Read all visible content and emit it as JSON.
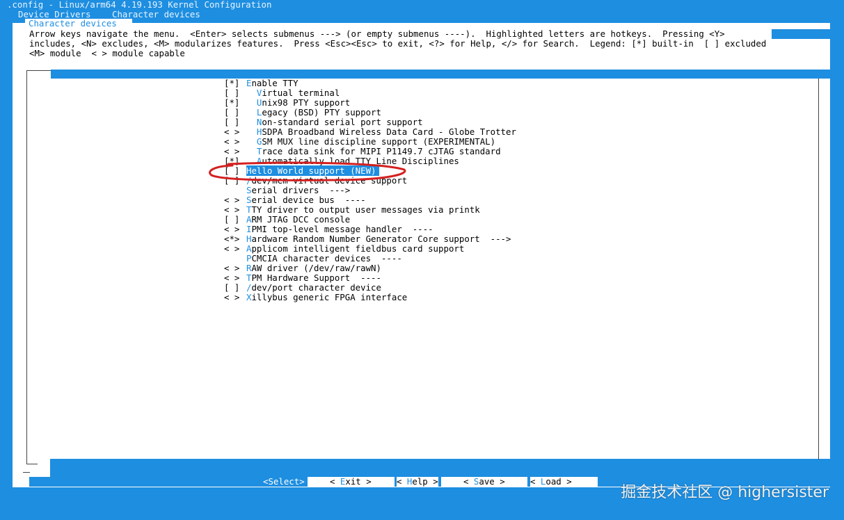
{
  "header": {
    "title": ".config - Linux/arm64 4.19.193 Kernel Configuration",
    "breadcrumb_1": "Device Drivers",
    "breadcrumb_2": "Character devices"
  },
  "dialog": {
    "title": "Character devices",
    "help_line_1": "Arrow keys navigate the menu.  <Enter> selects submenus ---> (or empty submenus ----).  Highlighted letters are hotkeys.  Pressing <Y>",
    "help_line_2": "includes, <N> excludes, <M> modularizes features.  Press <Esc><Esc> to exit, <?> for Help, </> for Search.  Legend: [*] built-in  [ ] excluded",
    "help_line_3": "<M> module  < > module capable"
  },
  "menu": {
    "items": [
      {
        "prefix": "[*]",
        "hotkey": "E",
        "rest": "nable TTY",
        "indent": ""
      },
      {
        "prefix": "[ ]",
        "hotkey": "V",
        "rest": "irtual terminal",
        "indent": "  "
      },
      {
        "prefix": "[*]",
        "hotkey": "U",
        "rest": "nix98 PTY support",
        "indent": "  "
      },
      {
        "prefix": "[ ]",
        "hotkey": "L",
        "rest": "egacy (BSD) PTY support",
        "indent": "  "
      },
      {
        "prefix": "[ ]",
        "hotkey": "N",
        "rest": "on-standard serial port support",
        "indent": "  "
      },
      {
        "prefix": "< >",
        "hotkey": "H",
        "rest": "SDPA Broadband Wireless Data Card - Globe Trotter",
        "indent": "  "
      },
      {
        "prefix": "< >",
        "hotkey": "G",
        "rest": "SM MUX line discipline support (EXPERIMENTAL)",
        "indent": "  "
      },
      {
        "prefix": "< >",
        "hotkey": "T",
        "rest": "race data sink for MIPI P1149.7 cJTAG standard",
        "indent": "  "
      },
      {
        "prefix": "[*]",
        "hotkey": "A",
        "rest": "utomatically load TTY Line Disciplines",
        "indent": "  "
      },
      {
        "prefix": "[ ]",
        "hotkey": "H",
        "rest": "ello World support (NEW)",
        "indent": ""
      },
      {
        "prefix": "[ ]",
        "hotkey": "/",
        "rest": "dev/mem virtual device support",
        "indent": ""
      },
      {
        "prefix": "   ",
        "hotkey": "S",
        "rest": "erial drivers  --->",
        "indent": ""
      },
      {
        "prefix": "< >",
        "hotkey": "S",
        "rest": "erial device bus  ----",
        "indent": ""
      },
      {
        "prefix": "< >",
        "hotkey": "T",
        "rest": "TY driver to output user messages via printk",
        "indent": ""
      },
      {
        "prefix": "[ ]",
        "hotkey": "A",
        "rest": "RM JTAG DCC console",
        "indent": ""
      },
      {
        "prefix": "< >",
        "hotkey": "I",
        "rest": "PMI top-level message handler  ----",
        "indent": ""
      },
      {
        "prefix": "<*>",
        "hotkey": "H",
        "rest": "ardware Random Number Generator Core support  --->",
        "indent": ""
      },
      {
        "prefix": "< >",
        "hotkey": "A",
        "rest": "pplicom intelligent fieldbus card support",
        "indent": ""
      },
      {
        "prefix": "   ",
        "hotkey": "P",
        "rest": "CMCIA character devices  ----",
        "indent": ""
      },
      {
        "prefix": "< >",
        "hotkey": "R",
        "rest": "AW driver (/dev/raw/rawN)",
        "indent": ""
      },
      {
        "prefix": "< >",
        "hotkey": "T",
        "rest": "PM Hardware Support  ----",
        "indent": ""
      },
      {
        "prefix": "[ ]",
        "hotkey": "/",
        "rest": "dev/port character device",
        "indent": ""
      },
      {
        "prefix": "< >",
        "hotkey": "X",
        "rest": "illybus generic FPGA interface",
        "indent": ""
      }
    ],
    "selected_index": 9
  },
  "buttons": {
    "select": "<Select>",
    "exit_pre": "< ",
    "exit_hk": "E",
    "exit_rest": "xit >",
    "help_pre": "< ",
    "help_hk": "H",
    "help_rest": "elp >",
    "save_pre": "< ",
    "save_hk": "S",
    "save_rest": "ave >",
    "load_pre": "< ",
    "load_hk": "L",
    "load_rest": "oad >"
  },
  "watermark": "掘金技术社区 @ highersister",
  "colors": {
    "background": "#1e8ee0",
    "dialog": "#ffffff",
    "hotkey": "#1e8ee0",
    "annotation": "#d42020"
  }
}
